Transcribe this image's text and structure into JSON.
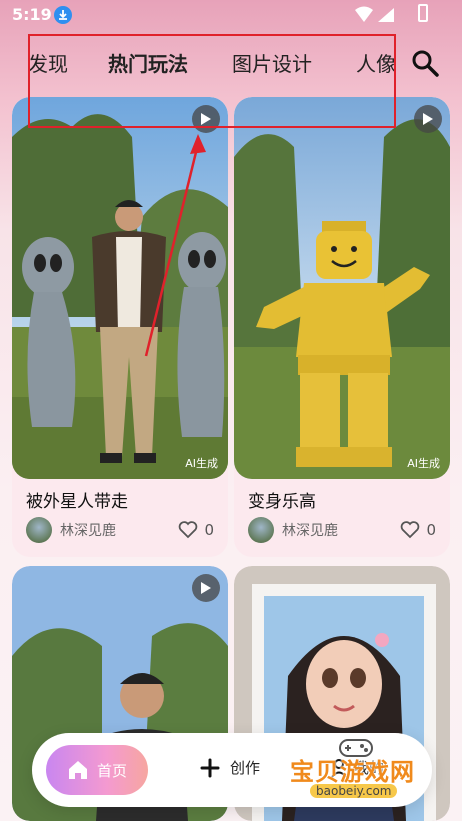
{
  "status_bar": {
    "time": "5:19"
  },
  "tabs": [
    {
      "label": "发现"
    },
    {
      "label": "热门玩法"
    },
    {
      "label": "图片设计"
    },
    {
      "label": "人像"
    }
  ],
  "cards": [
    {
      "title": "被外星人带走",
      "author": "林深见鹿",
      "likes": "0",
      "ai_badge": "AI生成"
    },
    {
      "title": "变身乐高",
      "author": "林深见鹿",
      "likes": "0",
      "ai_badge": "AI生成"
    }
  ],
  "bottom_nav": {
    "home": "首页",
    "create": "创作",
    "mine": "我的"
  },
  "watermark": {
    "title": "宝贝游戏网",
    "url": "baobeiy.com"
  },
  "colors": {
    "annotation": "#e0212b",
    "tab_indicator": "#a44e6b"
  }
}
